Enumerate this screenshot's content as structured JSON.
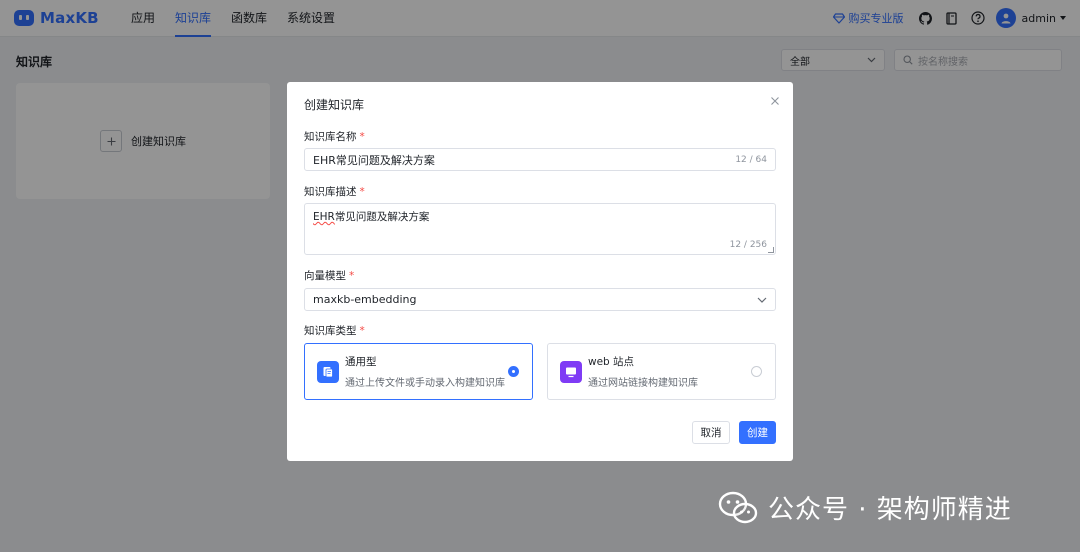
{
  "app": {
    "name": "MaxKB"
  },
  "nav": {
    "items": [
      {
        "label": "应用",
        "active": false
      },
      {
        "label": "知识库",
        "active": true
      },
      {
        "label": "函数库",
        "active": false
      },
      {
        "label": "系统设置",
        "active": false
      }
    ]
  },
  "header_right": {
    "pro_label": "购买专业版",
    "icons": [
      "github-icon",
      "book-icon",
      "help-icon"
    ],
    "user": "admin"
  },
  "page": {
    "title": "知识库",
    "filter_value": "全部",
    "search_placeholder": "按名称搜索",
    "create_card_label": "创建知识库"
  },
  "dialog": {
    "title": "创建知识库",
    "name_label": "知识库名称",
    "name_value": "EHR常见问题及解决方案",
    "name_counter": "12 / 64",
    "desc_label": "知识库描述",
    "desc_value_prefix": "EHR",
    "desc_value_rest": "常见问题及解决方案",
    "desc_counter": "12 / 256",
    "model_label": "向量模型",
    "model_value": "maxkb-embedding",
    "type_label": "知识库类型",
    "types": [
      {
        "name": "通用型",
        "desc": "通过上传文件或手动录入构建知识库",
        "selected": true
      },
      {
        "name": "web 站点",
        "desc": "通过网站链接构建知识库",
        "selected": false
      }
    ],
    "required_mark": "*",
    "cancel_label": "取消",
    "create_label": "创建"
  },
  "watermark": {
    "text": "公众号 · 架构师精进"
  },
  "colors": {
    "primary": "#3370ff",
    "required": "#f54a45",
    "web_type": "#7f3bf5"
  }
}
